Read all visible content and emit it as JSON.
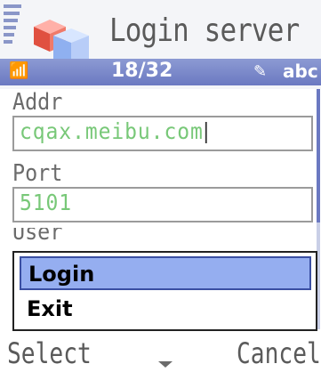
{
  "header": {
    "title": "Login server",
    "counter": "18/32",
    "input_mode": "abc",
    "icons": [
      "signal-strength-icon",
      "app-icon",
      "pen-icon"
    ]
  },
  "form": {
    "addr_label": "Addr",
    "addr_value": "cqax.meibu.com",
    "port_label": "Port",
    "port_value": "5101",
    "user_label": "User"
  },
  "menu": {
    "items": [
      "Login",
      "Exit"
    ],
    "selected_index": 0
  },
  "softkeys": {
    "left": "Select",
    "right": "Cancel"
  },
  "colors": {
    "status_bar": "#7b89c9",
    "field_text": "#78c878",
    "menu_highlight": "#95aef0"
  }
}
